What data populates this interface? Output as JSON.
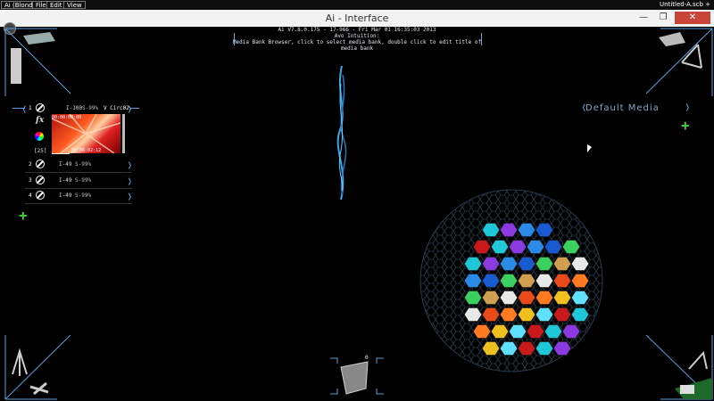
{
  "menubar": {
    "items": [
      "Ai (Blond!)",
      "File",
      "Edit",
      "View"
    ],
    "filename": "Untitled-A.scb +"
  },
  "window": {
    "title": "Ai - Interface",
    "min": "—",
    "max": "❐",
    "close": "✕"
  },
  "header": {
    "version": "Ai V7.8.0.175 - 17-966 - Fri Mar 01 16:35:03 2013",
    "subtitle": "Avo Intuition:",
    "hint": "Media Bank Browser, click to select media bank, double click to edit title of media bank"
  },
  "deck": {
    "main": {
      "num": "1",
      "level": "I-100",
      "speed": "S-99%",
      "clip": "V Circ02",
      "time_start": "00:00:00:00",
      "time_end": "00:00:02:12",
      "fx": "fx",
      "count": "[25]"
    },
    "rows": [
      {
        "num": "2",
        "level": "I-49",
        "speed": "S-99%"
      },
      {
        "num": "3",
        "level": "I-49",
        "speed": "S-99%"
      },
      {
        "num": "4",
        "level": "I-49",
        "speed": "S-99%"
      }
    ]
  },
  "media": {
    "label": "Default Media"
  },
  "bottom_counter": "0",
  "colors": {
    "accent": "#5a9fe0",
    "add": "#3fd23f",
    "close": "#c8453a"
  }
}
